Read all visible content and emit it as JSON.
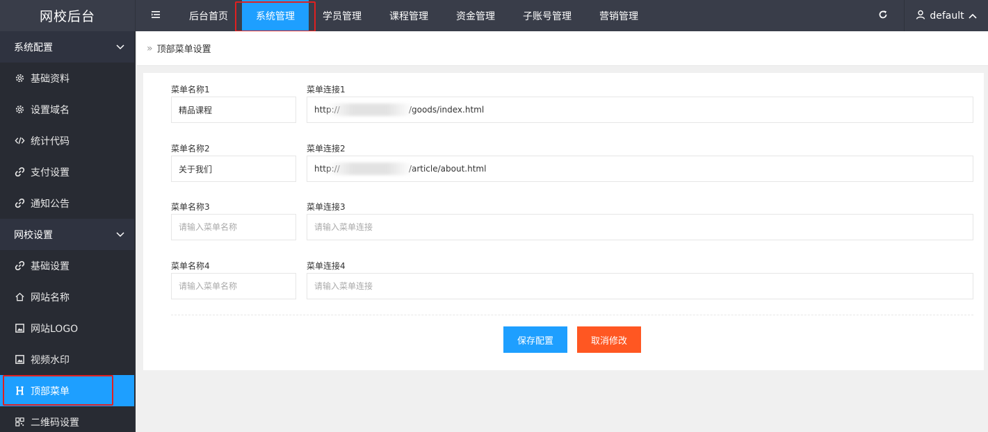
{
  "header": {
    "logo": "网校后台",
    "nav": [
      {
        "label": "后台首页"
      },
      {
        "label": "系统管理"
      },
      {
        "label": "学员管理"
      },
      {
        "label": "课程管理"
      },
      {
        "label": "资金管理"
      },
      {
        "label": "子账号管理"
      },
      {
        "label": "营销管理"
      }
    ],
    "active_nav": "系统管理",
    "user": "default"
  },
  "sidebar": {
    "group1": {
      "label": "系统配置"
    },
    "group1_items": [
      {
        "label": "基础资料",
        "icon": "gear-icon"
      },
      {
        "label": "设置域名",
        "icon": "gear-icon"
      },
      {
        "label": "统计代码",
        "icon": "code-icon"
      },
      {
        "label": "支付设置",
        "icon": "link-icon"
      },
      {
        "label": "通知公告",
        "icon": "link-icon"
      }
    ],
    "group2": {
      "label": "网校设置"
    },
    "group2_items": [
      {
        "label": "基础设置",
        "icon": "link-icon"
      },
      {
        "label": "网站名称",
        "icon": "home-icon"
      },
      {
        "label": "网站LOGO",
        "icon": "image-icon"
      },
      {
        "label": "视频水印",
        "icon": "image-icon"
      },
      {
        "label": "顶部菜单",
        "icon": "h-icon"
      },
      {
        "label": "二维码设置",
        "icon": "qrcode-icon"
      }
    ],
    "active_item": "顶部菜单"
  },
  "breadcrumb": {
    "sep": "»",
    "current": "顶部菜单设置"
  },
  "form": {
    "rows": [
      {
        "name_label": "菜单名称1",
        "link_label": "菜单连接1",
        "name_value": "精品课程",
        "link_value": "http://                          /goods/index.html"
      },
      {
        "name_label": "菜单名称2",
        "link_label": "菜单连接2",
        "name_value": "关于我们",
        "link_value": "http://                          /article/about.html"
      },
      {
        "name_label": "菜单名称3",
        "link_label": "菜单连接3",
        "name_value": "",
        "link_value": ""
      },
      {
        "name_label": "菜单名称4",
        "link_label": "菜单连接4",
        "name_value": "",
        "link_value": ""
      }
    ],
    "name_placeholder": "请输入菜单名称",
    "link_placeholder": "请输入菜单连接",
    "save_label": "保存配置",
    "cancel_label": "取消修改"
  },
  "colors": {
    "topbar": "#393d49",
    "accent": "#1e9fff",
    "danger": "#ff5722",
    "highlight_box": "#e02020"
  }
}
